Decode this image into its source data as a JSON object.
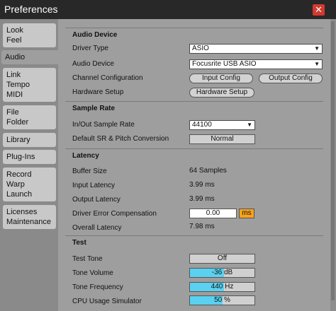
{
  "window": {
    "title": "Preferences",
    "close_glyph": "✕"
  },
  "sidebar": {
    "tabs": [
      {
        "lines": [
          "Look",
          "Feel"
        ]
      },
      {
        "lines": [
          "Audio"
        ],
        "active": true
      },
      {
        "lines": [
          "Link",
          "Tempo",
          "MIDI"
        ]
      },
      {
        "lines": [
          "File",
          "Folder"
        ]
      },
      {
        "lines": [
          "Library"
        ]
      },
      {
        "lines": [
          "Plug-Ins"
        ]
      },
      {
        "lines": [
          "Record",
          "Warp",
          "Launch"
        ]
      },
      {
        "lines": [
          "Licenses",
          "Maintenance"
        ]
      }
    ]
  },
  "audio_device": {
    "header": "Audio Device",
    "driver_type_label": "Driver Type",
    "driver_type_value": "ASIO",
    "audio_device_label": "Audio Device",
    "audio_device_value": "Focusrite USB ASIO",
    "channel_config_label": "Channel Configuration",
    "input_config_button": "Input Config",
    "output_config_button": "Output Config",
    "hardware_setup_label": "Hardware Setup",
    "hardware_setup_button": "Hardware Setup"
  },
  "sample_rate": {
    "header": "Sample Rate",
    "in_out_label": "In/Out Sample Rate",
    "in_out_value": "44100",
    "default_sr_label": "Default SR & Pitch Conversion",
    "default_sr_value": "Normal"
  },
  "latency": {
    "header": "Latency",
    "buffer_size_label": "Buffer Size",
    "buffer_size_value": "64 Samples",
    "input_latency_label": "Input Latency",
    "input_latency_value": "3.99 ms",
    "output_latency_label": "Output Latency",
    "output_latency_value": "3.99 ms",
    "driver_error_label": "Driver Error Compensation",
    "driver_error_value": "0.00",
    "driver_error_unit": "ms",
    "overall_latency_label": "Overall Latency",
    "overall_latency_value": "7.98 ms"
  },
  "test": {
    "header": "Test",
    "test_tone_label": "Test Tone",
    "test_tone_value": "Off",
    "tone_volume_label": "Tone Volume",
    "tone_volume_value": "-36 dB",
    "tone_volume_level": 0.53,
    "tone_frequency_label": "Tone Frequency",
    "tone_frequency_value": "440 Hz",
    "tone_frequency_level": 0.53,
    "cpu_sim_label": "CPU Usage Simulator",
    "cpu_sim_value": "50 %",
    "cpu_sim_level": 0.5
  },
  "colors": {
    "accent_fill": "#5ad1f0",
    "unit_badge": "#f7a21b",
    "close_button": "#d23a2f"
  },
  "icons": {
    "dropdown": "triangle-down-icon",
    "close": "close-icon"
  }
}
